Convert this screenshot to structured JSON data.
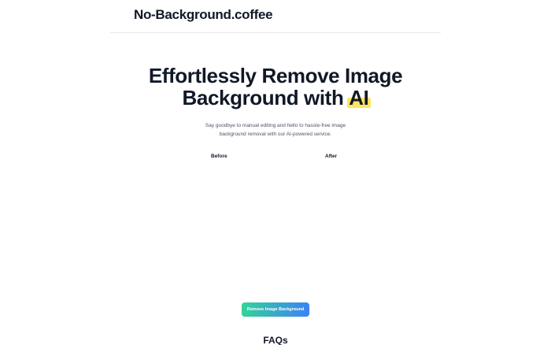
{
  "header": {
    "logo_text": "No-Background.coffee"
  },
  "hero": {
    "title_line1": "Effortlessly Remove Image",
    "title_line2_prefix": "Background with ",
    "title_highlight": "AI",
    "highlight_color": "#fde047",
    "subtitle": "Say goodbye to manual editing and hello to hassle-free image background removal with our AI-powered service."
  },
  "comparison": {
    "before_label": "Before",
    "after_label": "After"
  },
  "cta": {
    "label": "Remove Image Background",
    "gradient_start": "#34d399",
    "gradient_end": "#3b82f6"
  },
  "faq": {
    "title": "FAQs"
  }
}
